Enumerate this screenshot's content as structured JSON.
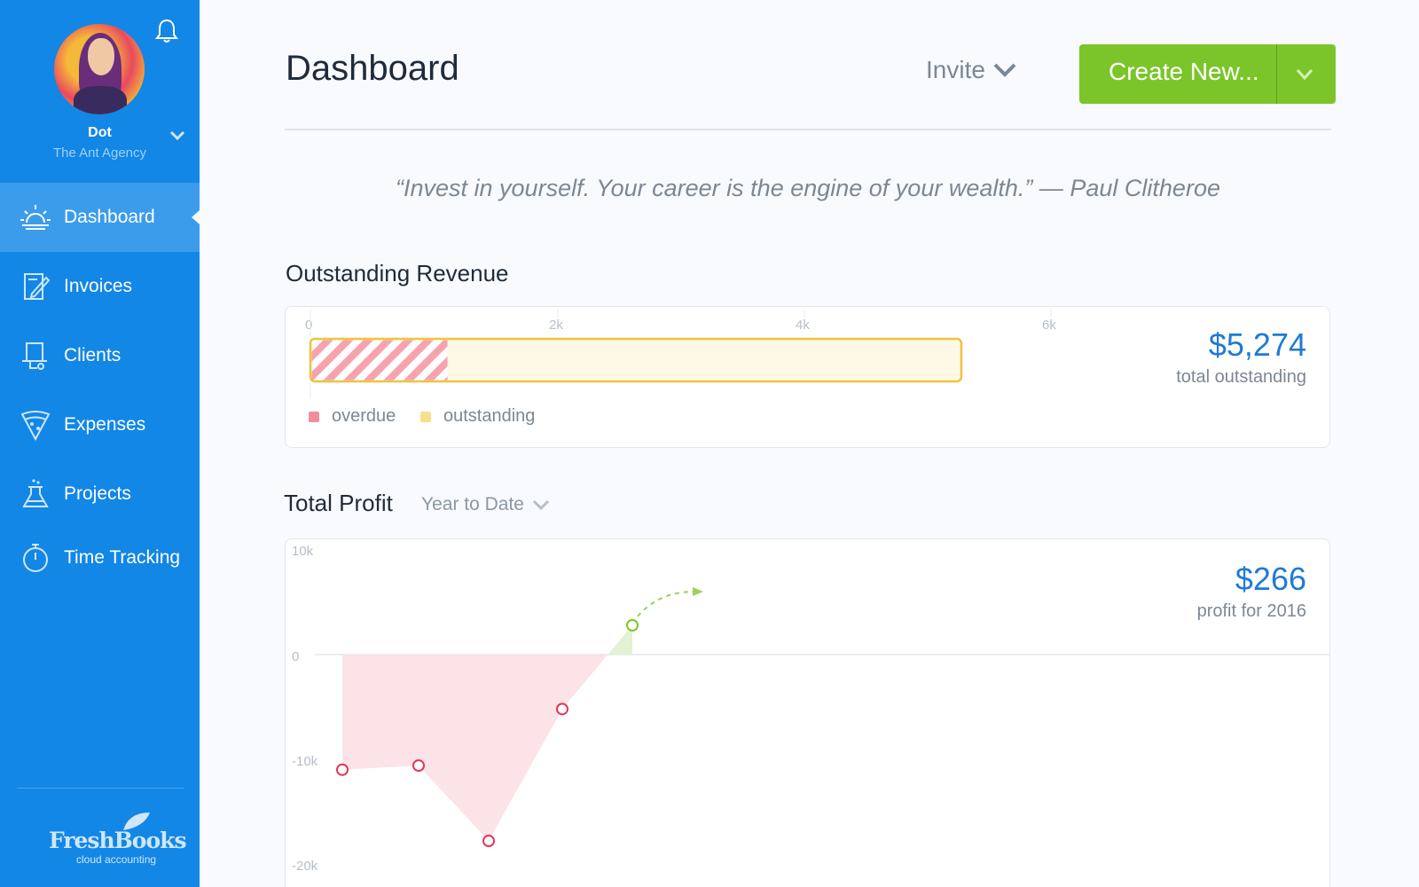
{
  "user": {
    "name": "Dot",
    "org": "The Ant Agency"
  },
  "sidebar": {
    "items": [
      {
        "label": "Dashboard",
        "icon": "sunrise-icon"
      },
      {
        "label": "Invoices",
        "icon": "invoice-icon"
      },
      {
        "label": "Clients",
        "icon": "clients-icon"
      },
      {
        "label": "Expenses",
        "icon": "pizza-icon"
      },
      {
        "label": "Projects",
        "icon": "flask-icon"
      },
      {
        "label": "Time Tracking",
        "icon": "stopwatch-icon"
      }
    ],
    "active": "Dashboard",
    "logo": "FreshBooks",
    "logo_sub": "cloud accounting"
  },
  "header": {
    "title": "Dashboard",
    "invite_label": "Invite",
    "create_label": "Create New..."
  },
  "quote": "“Invest in yourself. Your career is the engine of your wealth.” — Paul Clitheroe",
  "outstanding": {
    "title": "Outstanding Revenue",
    "amount": "$5,274",
    "caption": "total outstanding",
    "legend": {
      "overdue": "overdue",
      "outstanding": "outstanding"
    }
  },
  "profit": {
    "title": "Total Profit",
    "range": "Year to Date",
    "amount": "$266",
    "caption": "profit for 2016"
  },
  "colors": {
    "sidebar": "#1287e6",
    "accent_blue": "#1f7ad6",
    "create_green": "#7bc52a",
    "overdue_pink": "#f18d9c",
    "outstanding_yellow": "#f6e08d",
    "loss_red": "#e63356",
    "gain_green": "#7bc52a"
  },
  "chart_data": [
    {
      "type": "bar",
      "orientation": "horizontal",
      "ticks": [
        "0",
        "2k",
        "4k",
        "6k"
      ],
      "xlim": [
        0,
        7000
      ],
      "series": [
        {
          "name": "overdue",
          "values": [
            1100
          ]
        },
        {
          "name": "outstanding",
          "values": [
            4174
          ]
        }
      ],
      "total": 5274,
      "legend": "bottom-left"
    },
    {
      "type": "line",
      "ytick_labels": [
        "10k",
        "0",
        "-10k",
        "-20k"
      ],
      "ylim": [
        -20000,
        10000
      ],
      "points": [
        {
          "x": 1,
          "y": -11000
        },
        {
          "x": 2,
          "y": -10600
        },
        {
          "x": 3,
          "y": -17800
        },
        {
          "x": 4,
          "y": -5200
        },
        {
          "x": 5,
          "y": 2800
        }
      ],
      "area_fill": true
    }
  ]
}
